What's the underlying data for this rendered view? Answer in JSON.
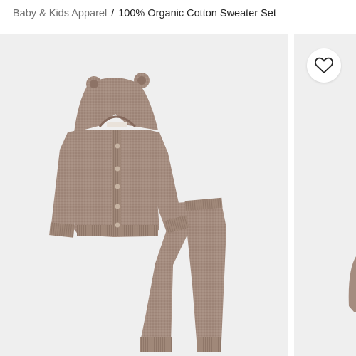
{
  "breadcrumb": {
    "parent": "Baby & Kids Apparel",
    "separator": "/",
    "current": "100% Organic Cotton Sweater Set"
  },
  "gallery": {
    "favorite_icon": "heart-outline-icon",
    "panel_color": "#efefef",
    "knit_color": "#a48c7f"
  }
}
